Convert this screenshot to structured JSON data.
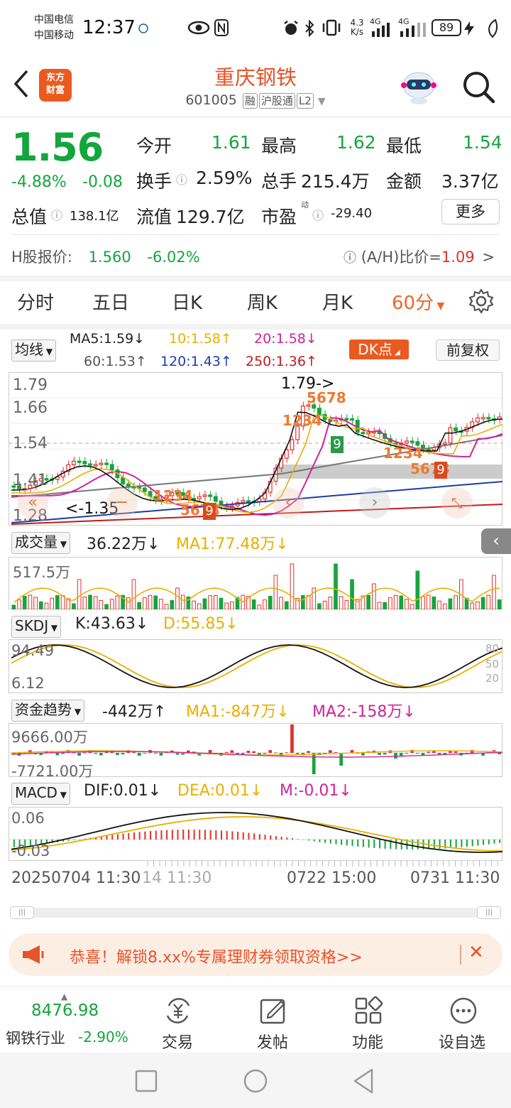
{
  "status": {
    "carrier1": "中国电信",
    "carrier2": "中国移动",
    "time": "12:37",
    "speed_top": "4.3",
    "speed_bottom": "K/s",
    "net1": "4G",
    "net2": "4G",
    "battery": "89"
  },
  "header": {
    "logo_line1": "东方",
    "logo_line2": "财富",
    "stock_name": "重庆钢铁",
    "stock_code": "601005",
    "tag1": "融",
    "tag2": "沪股通",
    "tag3": "L2"
  },
  "quote": {
    "price": "1.56",
    "change_pct": "-4.88%",
    "change_amt": "-0.08",
    "open_label": "今开",
    "open": "1.61",
    "high_label": "最高",
    "high": "1.62",
    "low_label": "最低",
    "low": "1.54",
    "turnover_label": "换手",
    "turnover": "2.59%",
    "volume_label": "总手",
    "volume": "215.4万",
    "amount_label": "金额",
    "amount": "3.37亿",
    "mcap_label": "总值",
    "mcap": "138.1亿",
    "float_label": "流值",
    "float_mcap": "129.7亿",
    "pe_label": "市盈",
    "pe_sup": "动",
    "pe": "-29.40",
    "more_btn": "更多",
    "h_label": "H股报价:",
    "h_price": "1.560",
    "h_pct": "-6.02%",
    "ah_label": "(A/H)比价=",
    "ah_value": "1.09",
    "ah_arrow": ">"
  },
  "tabs": [
    "分时",
    "五日",
    "日K",
    "周K",
    "月K",
    "60分"
  ],
  "tab_active_index": 5,
  "ma_bar": {
    "select": "均线",
    "ma5": "MA5:1.59↓",
    "ma10": "10:1.58↑",
    "ma20": "20:1.58↓",
    "ma60": "60:1.53↑",
    "ma120": "120:1.43↑",
    "ma250": "250:1.36↑",
    "dk": "DK点",
    "fq": "前复权"
  },
  "kline": {
    "y_labels": [
      "1.79",
      "1.66",
      "1.54",
      "1.41",
      "1.28"
    ],
    "max_annot": "1.79->",
    "min_annot": "<-1.35",
    "seq_a": "1234",
    "seq_b": "5678",
    "seq_c": "9"
  },
  "volume": {
    "select": "成交量",
    "value": "36.22万↓",
    "ma1": "MA1:77.48万↓",
    "axis": "517.5万"
  },
  "skdj": {
    "select": "SKDJ",
    "k": "K:43.63↓",
    "d": "D:55.85↓",
    "axis_top": "94.49",
    "axis_bottom": "6.12",
    "ref80": "80",
    "ref50": "50",
    "ref20": "20"
  },
  "capital": {
    "select": "资金趋势",
    "value": "-442万↑",
    "ma1": "MA1:-847万↓",
    "ma2": "MA2:-158万↓",
    "axis_top": "9666.00万",
    "axis_bottom": "-7721.00万"
  },
  "macd": {
    "select": "MACD",
    "dif": "DIF:0.01↓",
    "dea": "DEA:0.01↓",
    "m": "M:-0.01↓",
    "axis_top": "0.06",
    "axis_bottom": "-0.03"
  },
  "time_axis": [
    "20250704 11:30",
    "14 11:30",
    "0722 15:00",
    "0731 11:30"
  ],
  "banner": {
    "text": "恭喜！解锁8.xx%专属理财券领取资格>>",
    "close": "✕"
  },
  "bottom": {
    "index_value": "8476.98",
    "index_name": "钢铁行业",
    "index_pct": "-2.90%",
    "trade": "交易",
    "post": "发帖",
    "func": "功能",
    "watch": "设自选"
  },
  "colors": {
    "up": "#e0302a",
    "down": "#14a53c",
    "accent": "#e8532a",
    "ma5": "#111111",
    "ma10": "#e8b000",
    "ma20": "#d0239a",
    "ma60": "#666666",
    "ma120": "#1b3ea8",
    "ma250": "#c01c1c"
  }
}
